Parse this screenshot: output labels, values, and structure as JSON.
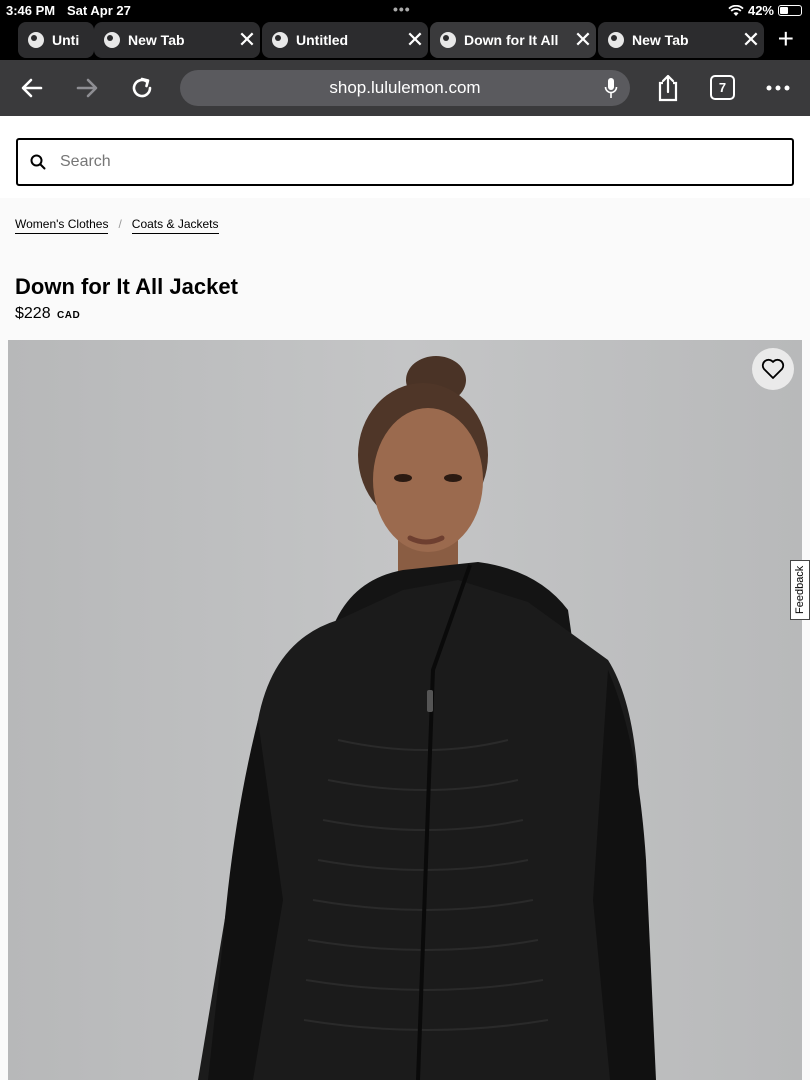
{
  "status": {
    "time": "3:46 PM",
    "date": "Sat Apr 27",
    "battery": "42%",
    "battery_level": 0.42
  },
  "tabs": [
    {
      "label": "Unti",
      "active": false
    },
    {
      "label": "New Tab",
      "active": false
    },
    {
      "label": "Untitled",
      "active": false
    },
    {
      "label": "Down for It All",
      "active": true
    },
    {
      "label": "New Tab",
      "active": false
    }
  ],
  "toolbar": {
    "url": "shop.lululemon.com",
    "tab_count": "7"
  },
  "search": {
    "placeholder": "Search"
  },
  "breadcrumb": [
    "Women's Clothes",
    "Coats & Jackets"
  ],
  "product": {
    "title": "Down for It All Jacket",
    "price": "$228",
    "currency": "CAD"
  },
  "feedback_label": "Feedback",
  "colors": {
    "tab_bg": "#2c2c2e",
    "toolbar_bg": "#3a3a3c",
    "image_bg": "#c2c3c4"
  }
}
